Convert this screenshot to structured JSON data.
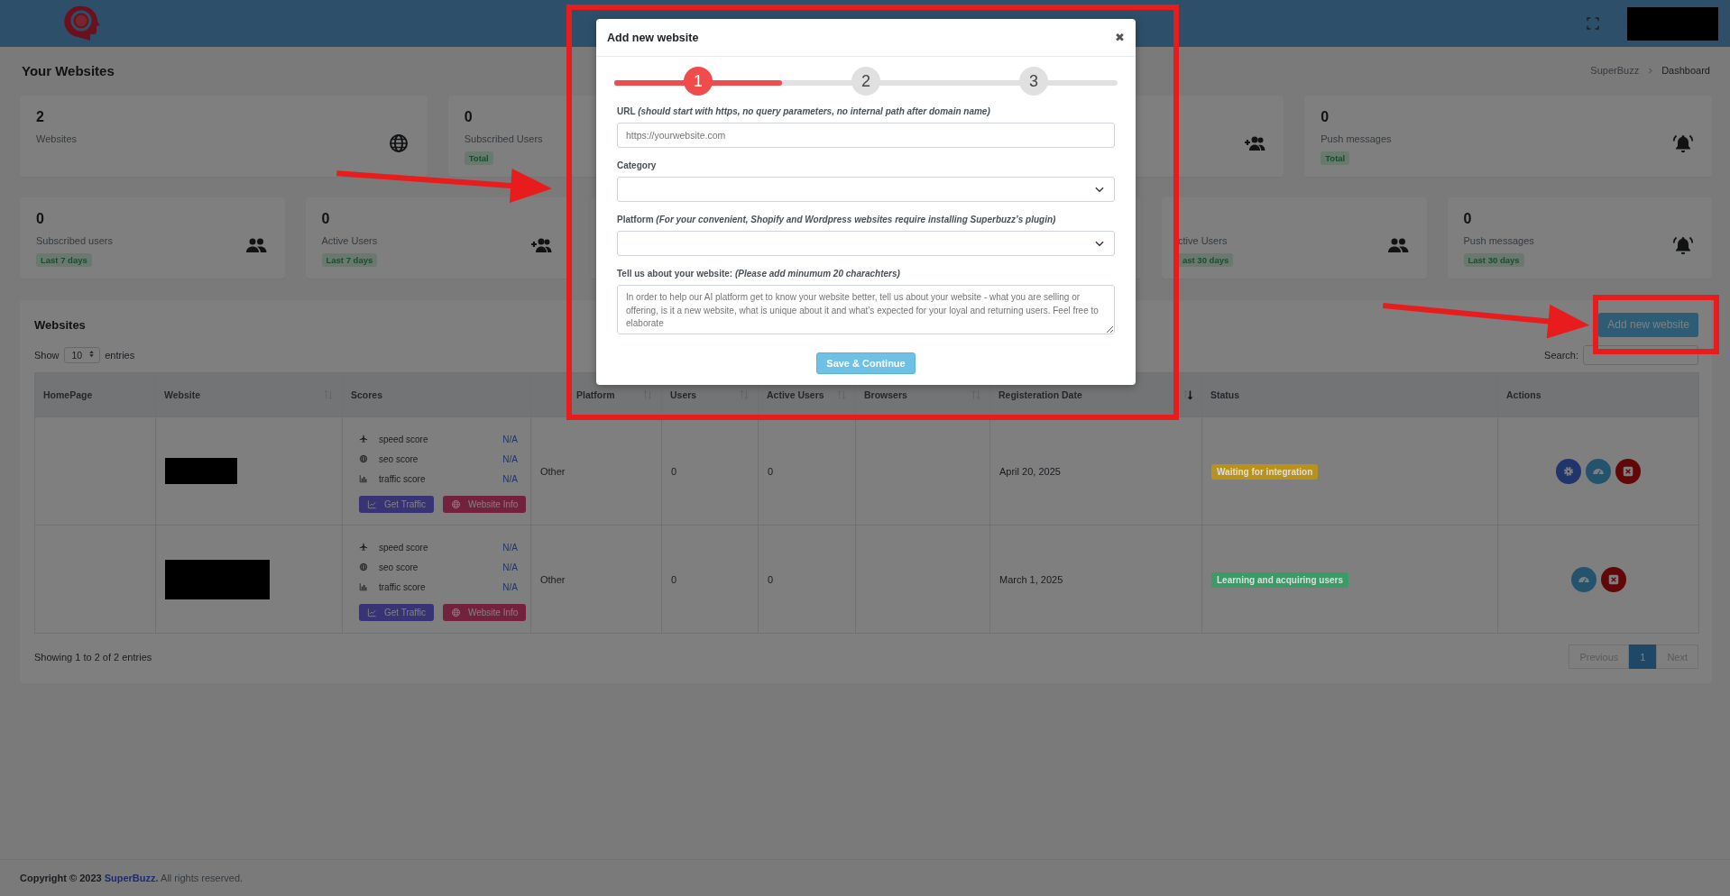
{
  "header": {
    "user_redacted": true
  },
  "page": {
    "title": "Your Websites",
    "breadcrumb": [
      {
        "label": "SuperBuzz",
        "selected": false
      },
      {
        "label": "Dashboard",
        "selected": true
      }
    ]
  },
  "stats_top": [
    {
      "kind": "websites",
      "value": "2",
      "label": "Websites"
    },
    {
      "kind": "plain",
      "value": "0",
      "label": "Subscribed Users",
      "badge": "Total"
    },
    {
      "kind": "active"
    },
    {
      "kind": "push",
      "value": "0",
      "label": "Push messages",
      "badge": "Total"
    }
  ],
  "stats_bottom": [
    {
      "kind": "subscribers",
      "value": "0",
      "label": "Subscribed users",
      "badge": "Last 7 days"
    },
    {
      "kind": "active",
      "value": "0",
      "label": "Active Users",
      "badge": "Last 7 days"
    },
    {
      "kind": "covered"
    },
    {
      "kind": "covered"
    },
    {
      "kind": "subscribers",
      "label": "ctive Users",
      "badge": "ast 30 days"
    },
    {
      "kind": "push",
      "value": "0",
      "label": "Push messages",
      "badge": "Last 30 days"
    }
  ],
  "panel": {
    "title": "Websites",
    "add_button": "Add new website",
    "show_label": "Show",
    "page_size": "10",
    "entries_label": "entries",
    "search_label": "Search:",
    "columns": [
      {
        "label": "HomePage"
      },
      {
        "label": "Website",
        "sorted": false
      },
      {
        "label": "Scores"
      },
      {
        "label": "Platform",
        "sorted": false
      },
      {
        "label": "Users",
        "sorted": false
      },
      {
        "label": "Active Users",
        "sorted": false
      },
      {
        "label": "Browsers",
        "sorted": false
      },
      {
        "label": "Registeration Date",
        "sorted": true
      },
      {
        "label": "Status"
      },
      {
        "label": "Actions"
      }
    ],
    "rows": [
      {
        "website_redacted": true,
        "scores": [
          {
            "kind": "speed",
            "label": "speed score",
            "value": "N/A"
          },
          {
            "kind": "seo",
            "label": "seo score",
            "value": "N/A"
          },
          {
            "kind": "traffic",
            "label": "traffic score",
            "value": "N/A"
          }
        ],
        "buttons": [
          {
            "kind": "traffic",
            "label": "Get Traffic"
          },
          {
            "kind": "info",
            "label": "Website Info"
          }
        ],
        "platform": "Other",
        "subscribed": "0",
        "active": "0",
        "date": "April 20, 2025",
        "status": {
          "text": "Waiting for integration",
          "color": "#b8921a"
        },
        "actions": [
          {
            "kind": "settings"
          },
          {
            "kind": "stats"
          },
          {
            "kind": "delete"
          }
        ]
      },
      {
        "website_redacted": true,
        "scores": [
          {
            "kind": "speed",
            "label": "speed score",
            "value": "N/A"
          },
          {
            "kind": "seo",
            "label": "seo score",
            "value": "N/A"
          },
          {
            "kind": "traffic",
            "label": "traffic score",
            "value": "N/A"
          }
        ],
        "buttons": [
          {
            "kind": "traffic",
            "label": "Get Traffic"
          },
          {
            "kind": "info",
            "label": "Website Info"
          }
        ],
        "platform": "Other",
        "subscribed": "0",
        "active": "0",
        "date": "March 1, 2025",
        "status": {
          "text": "Learning and acquiring users",
          "color": "#3b9a68"
        },
        "actions": [
          {
            "kind": "stats"
          },
          {
            "kind": "delete"
          }
        ]
      }
    ],
    "summary": "Showing 1 to 2 of 2 entries",
    "pagination": [
      {
        "label": "Previous",
        "selected": false
      },
      {
        "label": "1",
        "selected": true
      },
      {
        "label": "Next",
        "selected": false
      }
    ]
  },
  "modal": {
    "title": "Add new website",
    "close": "✖",
    "stepper": {
      "level": 0.333,
      "steps": [
        {
          "label": "1",
          "selected": true
        },
        {
          "label": "2",
          "selected": false
        },
        {
          "label": "3",
          "selected": false
        }
      ]
    },
    "fields": [
      {
        "kind": "text",
        "label": "URL *(should start with https, no query parameters, no internal path after domain name)*",
        "placeholder": "https://yourwebsite.com"
      },
      {
        "kind": "select",
        "label": "Category"
      },
      {
        "kind": "select",
        "label": "Platform *(For your convenient, Shopify and Wordpress websites require installing Superbuzz’s plugin)*"
      },
      {
        "kind": "textarea",
        "label": "Tell us about your website: *(Please add minumum 20 charachters)*",
        "placeholder": "In order to help our AI platform get to know your website better, tell us about your website - what you are selling or offering, is it a new website, what is unique about it and what’s expected for your loyal and returning users. Feel free to elaborate"
      }
    ],
    "submit": "Save & Continue"
  },
  "footer": {
    "text_before": "Copyright © 2023",
    "link": "SuperBuzz.",
    "text_after": "All rights reserved."
  },
  "annotations": [
    {
      "kind": "frame"
    },
    {
      "kind": "arrow"
    },
    {
      "kind": "arrow"
    },
    {
      "kind": "frame"
    }
  ]
}
